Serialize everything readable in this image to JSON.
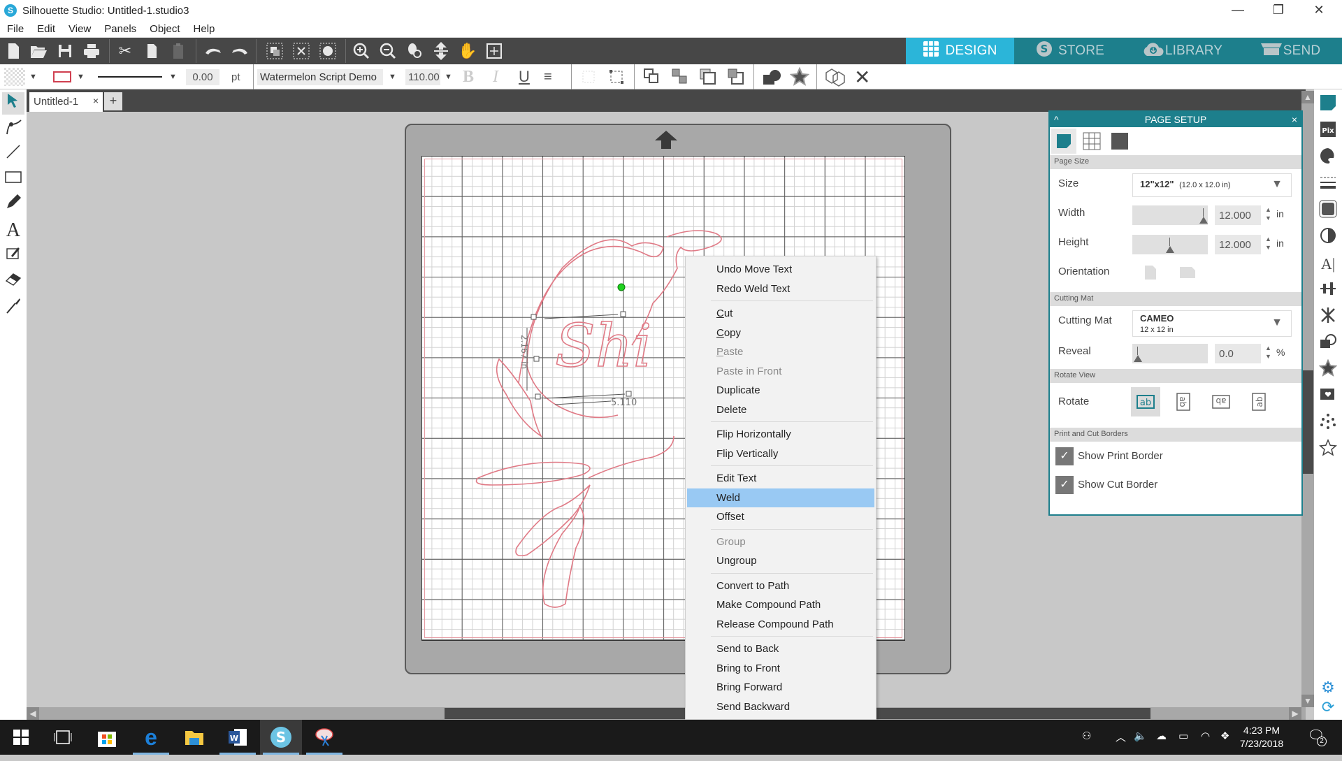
{
  "window": {
    "title": "Silhouette Studio: Untitled-1.studio3",
    "controls": {
      "minimize": "—",
      "maximize": "❐",
      "close": "✕"
    }
  },
  "menubar": [
    "File",
    "Edit",
    "View",
    "Panels",
    "Object",
    "Help"
  ],
  "toolbar": {
    "icons": [
      "new-document",
      "open-folder",
      "save",
      "print",
      "cut",
      "copy",
      "paste",
      "undo",
      "redo",
      "select-all",
      "deselect",
      "select-by-color",
      "zoom-in",
      "zoom-out",
      "zoom-selection",
      "zoom-fit",
      "pan-hand",
      "fit-to-page"
    ],
    "nav_tabs": [
      {
        "label": "DESIGN",
        "icon": "grid-icon",
        "active": true
      },
      {
        "label": "STORE",
        "icon": "silhouette-s-icon",
        "active": false
      },
      {
        "label": "LIBRARY",
        "icon": "cloud-download-icon",
        "active": false
      },
      {
        "label": "SEND",
        "icon": "cutter-icon",
        "active": false
      }
    ],
    "colors": {
      "nav_active": "#2bb5d9",
      "nav_inactive": "#1d7f8c",
      "dark_bar": "#474747"
    }
  },
  "properties": {
    "line_width": "0.00",
    "line_unit": "pt",
    "font_name": "Watermelon Script Demo",
    "font_size": "110.00",
    "bold": "B",
    "italic": "I",
    "underline": "U"
  },
  "document_tabs": [
    {
      "label": "Untitled-1",
      "close": "×"
    }
  ],
  "add_tab": "+",
  "canvas": {
    "design_text": "Shi",
    "dimension_width": "5.110",
    "dimension_height": "2.167 in"
  },
  "context_menu": {
    "items": [
      {
        "label": "Undo Move Text",
        "enabled": true
      },
      {
        "label": "Redo Weld Text",
        "enabled": true
      },
      {
        "sep": true
      },
      {
        "label": "Cut",
        "enabled": true,
        "mnemonic": "C"
      },
      {
        "label": "Copy",
        "enabled": true,
        "mnemonic": "C"
      },
      {
        "label": "Paste",
        "enabled": false,
        "mnemonic": "P"
      },
      {
        "label": "Paste in Front",
        "enabled": false
      },
      {
        "label": "Duplicate",
        "enabled": true
      },
      {
        "label": "Delete",
        "enabled": true
      },
      {
        "sep": true
      },
      {
        "label": "Flip Horizontally",
        "enabled": true
      },
      {
        "label": "Flip Vertically",
        "enabled": true
      },
      {
        "sep": true
      },
      {
        "label": "Edit Text",
        "enabled": true
      },
      {
        "label": "Weld",
        "enabled": true,
        "highlighted": true
      },
      {
        "label": "Offset",
        "enabled": true
      },
      {
        "sep": true
      },
      {
        "label": "Group",
        "enabled": false
      },
      {
        "label": "Ungroup",
        "enabled": true
      },
      {
        "sep": true
      },
      {
        "label": "Convert to Path",
        "enabled": true
      },
      {
        "label": "Make Compound Path",
        "enabled": true
      },
      {
        "label": "Release Compound Path",
        "enabled": true
      },
      {
        "sep": true
      },
      {
        "label": "Send to Back",
        "enabled": true
      },
      {
        "label": "Bring to Front",
        "enabled": true
      },
      {
        "label": "Bring Forward",
        "enabled": true
      },
      {
        "label": "Send Backward",
        "enabled": true
      }
    ],
    "highlight_color": "#99c9f3"
  },
  "page_setup": {
    "title": "PAGE SETUP",
    "collapse": "^",
    "close": "×",
    "sections": {
      "page_size": "Page Size",
      "cutting_mat": "Cutting Mat",
      "rotate_view": "Rotate View",
      "borders": "Print and Cut Borders"
    },
    "size_label": "Size",
    "size_value": "12\"x12\"",
    "size_detail": "(12.0 x 12.0 in)",
    "width_label": "Width",
    "width_value": "12.000",
    "width_unit": "in",
    "height_label": "Height",
    "height_value": "12.000",
    "height_unit": "in",
    "orientation_label": "Orientation",
    "cutting_mat_label": "Cutting Mat",
    "cutting_mat_value": "CAMEO",
    "cutting_mat_detail": "12 x 12 in",
    "reveal_label": "Reveal",
    "reveal_value": "0.0",
    "reveal_unit": "%",
    "rotate_label": "Rotate",
    "rotate_options": [
      "ab",
      "ab-90",
      "ab-180",
      "ab-270"
    ],
    "rotate_selected": 0,
    "show_print_border": {
      "label": "Show Print Border",
      "checked": true
    },
    "show_cut_border": {
      "label": "Show Cut Border",
      "checked": true
    },
    "accent": "#1d7f8c"
  },
  "taskbar": {
    "apps": [
      "windows-start",
      "task-view",
      "microsoft-store",
      "edge",
      "file-explorer",
      "word",
      "silhouette-studio",
      "snipping-tool"
    ],
    "time": "4:23 PM",
    "date": "7/23/2018",
    "notification_count": "2"
  }
}
